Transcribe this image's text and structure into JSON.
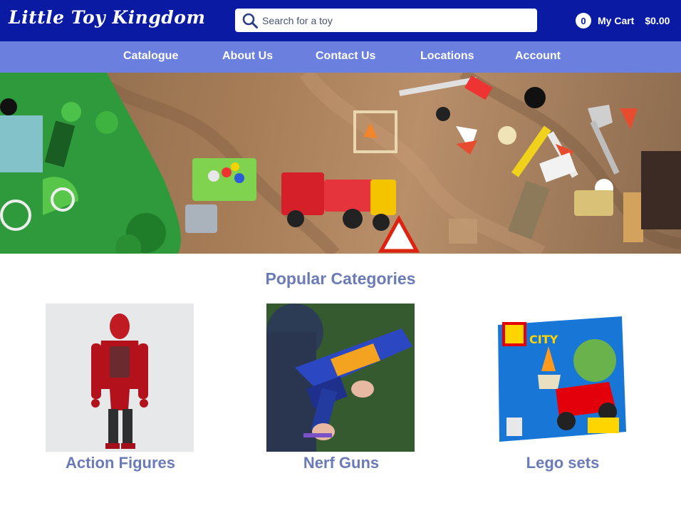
{
  "header": {
    "logo": "Little Toy Kingdom",
    "search": {
      "placeholder": "Search for a toy",
      "value": ""
    },
    "cart": {
      "count": "0",
      "label": "My Cart",
      "total": "$0.00"
    }
  },
  "nav": {
    "items": [
      {
        "label": "Catalogue"
      },
      {
        "label": "About Us"
      },
      {
        "label": "Contact Us"
      },
      {
        "label": "Locations"
      },
      {
        "label": "Account"
      }
    ]
  },
  "main": {
    "section_title": "Popular Categories",
    "categories": [
      {
        "label": "Action Figures"
      },
      {
        "label": "Nerf Guns"
      },
      {
        "label": "Lego sets"
      }
    ]
  },
  "colors": {
    "header_bg": "#0a1aa3",
    "nav_bg": "#6b7fdf",
    "accent_text": "#6b7bb8"
  }
}
